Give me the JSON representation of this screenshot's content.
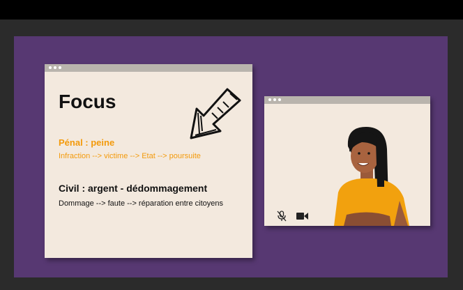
{
  "slide": {
    "focus_window": {
      "title": "Focus",
      "penal_heading": "Pénal : peine",
      "penal_text": "Infraction --> victime --> Etat --> poursuite",
      "civil_heading": "Civil : argent - dédommagement",
      "civil_text": "Dommage --> faute --> réparation entre citoyens",
      "arrow_icon": "hand-drawn-arrow-icon"
    },
    "video_window": {
      "mic_icon": "mic-muted-icon",
      "camera_icon": "video-camera-icon"
    }
  },
  "colors": {
    "slide_background": "#573872",
    "window_background": "#f3e9de",
    "window_bar": "#b9b4ad",
    "accent_orange": "#f39a0b",
    "text_dark": "#111111"
  }
}
